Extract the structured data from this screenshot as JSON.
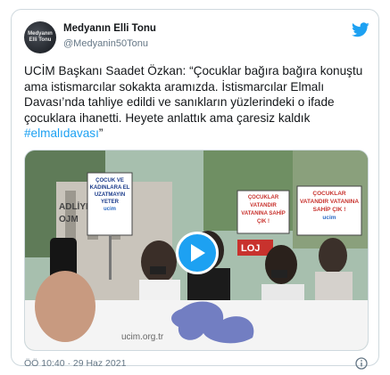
{
  "account": {
    "display_name": "Medyanın Elli Tonu",
    "handle": "@Medyanin50Tonu",
    "avatar_text_1": "Medyanın",
    "avatar_text_2": "Elli Tonu"
  },
  "tweet": {
    "text": "UCİM Başkanı Saadet Özkan: “Çocuklar bağıra bağıra konuştu ama istismarcılar sokakta aramızda. İstismarcılar Elmalı Davası’nda tahliye edildi ve  sanıkların yüzlerindeki o ifade çocuklara ihanetti. Heyete anlattık ama çaresiz kaldık ",
    "hashtag": "#elmalıdavası",
    "closing": "”",
    "timestamp": "ÖÖ 10:40 · 29 Haz 2021"
  },
  "media": {
    "sign_left": "ÇOCUK VE KADINLARA EL UZATMAYIN YETER",
    "sign_left_sub": "ucim",
    "sign_mid": "ÇOCUKLAR VATANDIR VATANINA SAHİP ÇIK !",
    "sign_right": "ÇOCUKLAR VATANDIR VATANINA SAHİP ÇIK !",
    "sign_right_sub": "ucim",
    "building_text_1": "ADLİYE",
    "building_text_2": "OJM",
    "red_sign": "LOJ",
    "banner_text": "ucim.org.tr"
  },
  "colors": {
    "accent": "#1da1f2",
    "text_secondary": "#657786"
  },
  "icons": {
    "brand": "twitter-bird-icon",
    "play": "play-icon",
    "info": "info-icon"
  }
}
